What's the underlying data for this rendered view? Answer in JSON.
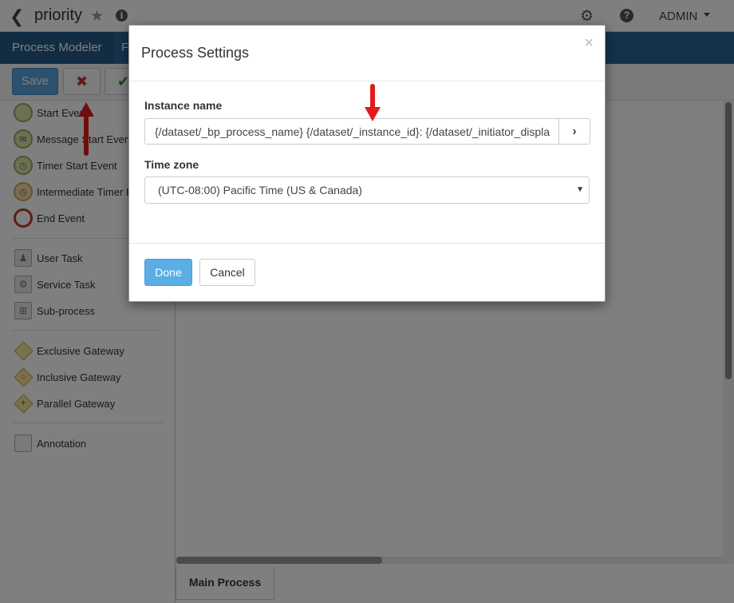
{
  "header": {
    "back_icon": "chevron-left-icon",
    "process_name": "priority",
    "star_icon": "star-icon",
    "info_icon": "info-icon",
    "settings_icon": "gear-icon",
    "help_icon": "help-icon",
    "user_label": "ADMIN"
  },
  "navbar": {
    "tabs": [
      {
        "label": "Process Modeler"
      },
      {
        "label": "F"
      }
    ]
  },
  "toolbar": {
    "save_label": "Save",
    "settings_tool_icon": "tools-icon",
    "validate_icon": "check-icon"
  },
  "palette": {
    "events": [
      {
        "label": "Start Event"
      },
      {
        "label": "Message Start Event"
      },
      {
        "label": "Timer Start Event"
      },
      {
        "label": "Intermediate Timer Event"
      },
      {
        "label": "End Event"
      }
    ],
    "tasks": [
      {
        "label": "User Task"
      },
      {
        "label": "Service Task"
      },
      {
        "label": "Sub-process"
      }
    ],
    "gateways": [
      {
        "label": "Exclusive Gateway"
      },
      {
        "label": "Inclusive Gateway"
      },
      {
        "label": "Parallel Gateway"
      }
    ],
    "other": [
      {
        "label": "Annotation"
      }
    ]
  },
  "bottom_tabs": [
    {
      "label": "Main Process"
    }
  ],
  "modal": {
    "title": "Process Settings",
    "close_label": "×",
    "instance_name": {
      "label": "Instance name",
      "value": "{/dataset/_bp_process_name} {/dataset/_instance_id}: {/dataset/_initiator_display_name}",
      "addon": "›"
    },
    "time_zone": {
      "label": "Time zone",
      "selected": "(UTC-08:00) Pacific Time (US & Canada)"
    },
    "done_label": "Done",
    "cancel_label": "Cancel"
  },
  "colors": {
    "navbar": "#2a6496",
    "primary_button": "#5aaee5",
    "annotation_arrow": "#ee1111"
  }
}
